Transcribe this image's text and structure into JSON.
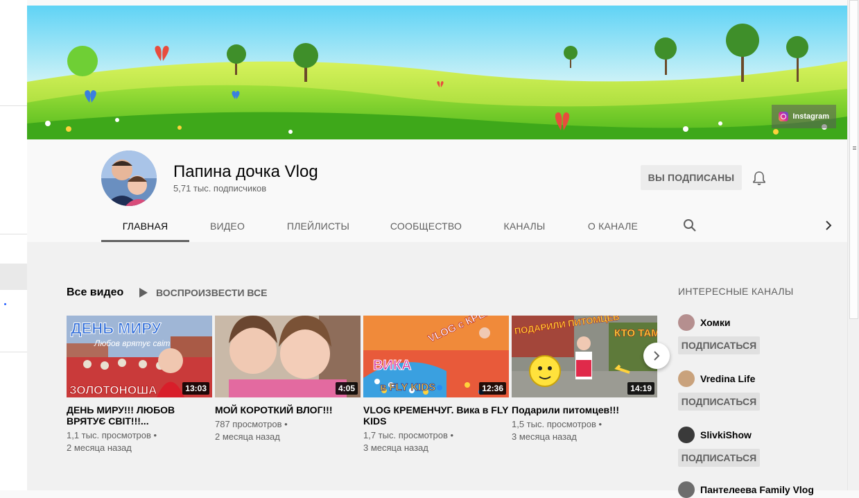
{
  "banner": {
    "links": [
      {
        "label": "Instagram",
        "icon": "instagram-icon"
      }
    ]
  },
  "channel": {
    "title": "Папина дочка Vlog",
    "subscribers": "5,71 тыс. подписчиков",
    "subscribe_label": "ВЫ ПОДПИСАНЫ",
    "bell_icon": "bell-icon"
  },
  "tabs": [
    {
      "label": "ГЛАВНАЯ",
      "active": true
    },
    {
      "label": "ВИДЕО"
    },
    {
      "label": "ПЛЕЙЛИСТЫ"
    },
    {
      "label": "СООБЩЕСТВО"
    },
    {
      "label": "КАНАЛЫ"
    },
    {
      "label": "О КАНАЛЕ"
    }
  ],
  "section": {
    "title": "Все видео",
    "play_all": "ВОСПРОИЗВЕСТИ ВСЕ"
  },
  "videos": [
    {
      "title": "ДЕНЬ МИРУ!!! ЛЮБОВ ВРЯТУЄ СВІТ!!!...",
      "duration": "13:03",
      "views": "1,1 тыс. просмотров •",
      "age": "2 месяца назад",
      "thumb_text_top": "ДЕНЬ МИРУ",
      "thumb_text_mid": "Любов врятує світ",
      "thumb_text_bottom": "ЗОЛОТОНОША"
    },
    {
      "title": "МОЙ КОРОТКИЙ ВЛОГ!!!",
      "duration": "4:05",
      "views": "787 просмотров •",
      "age": "2 месяца назад"
    },
    {
      "title": "VLOG КРЕМЕНЧУГ. Вика в FLY KIDS",
      "duration": "12:36",
      "views": "1,7 тыс. просмотров •",
      "age": "3 месяца назад",
      "thumb_text_top": "VLOG с КРЕМЕНЧУГ",
      "thumb_text_mid": "ВИКА",
      "thumb_text_bottom": "в FLY KIDS"
    },
    {
      "title": "Подарили питомцев!!!",
      "duration": "14:19",
      "views": "1,5 тыс. просмотров •",
      "age": "3 месяца назад",
      "thumb_text_top": "ПОДАРИЛИ ПИТОМЦЕВ",
      "thumb_text_mid": "КТО ТАМ?"
    }
  ],
  "related": {
    "title": "ИНТЕРЕСНЫЕ КАНАЛЫ",
    "subscribe_label": "ПОДПИСАТЬСЯ",
    "channels": [
      {
        "name": "Хомки",
        "color": "#b58f8f"
      },
      {
        "name": "Vredina Life",
        "color": "#c9a27c"
      },
      {
        "name": "SlivkiShow",
        "color": "#3a3a3a"
      },
      {
        "name": "Пантелеева Family Vlog",
        "color": "#6d6d6d"
      }
    ]
  },
  "colors": {
    "accent_text": "#030303",
    "secondary_text": "#606060",
    "button_bg": "#ececec"
  }
}
